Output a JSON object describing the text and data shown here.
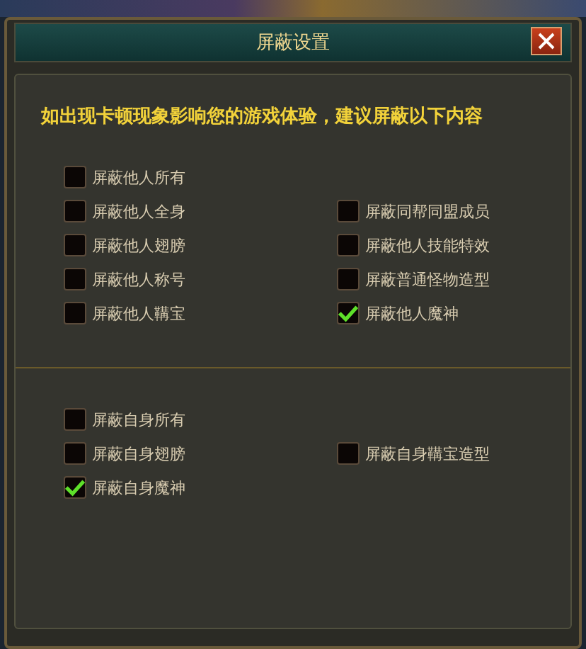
{
  "window": {
    "title": "屏蔽设置"
  },
  "notice": "如出现卡顿现象影响您的游戏体验，建议屏蔽以下内容",
  "sections": [
    {
      "rows": [
        {
          "left": {
            "label": "屏蔽他人所有",
            "checked": false
          }
        },
        {
          "left": {
            "label": "屏蔽他人全身",
            "checked": false
          },
          "right": {
            "label": "屏蔽同帮同盟成员",
            "checked": false
          }
        },
        {
          "left": {
            "label": "屏蔽他人翅膀",
            "checked": false
          },
          "right": {
            "label": "屏蔽他人技能特效",
            "checked": false
          }
        },
        {
          "left": {
            "label": "屏蔽他人称号",
            "checked": false
          },
          "right": {
            "label": "屏蔽普通怪物造型",
            "checked": false
          }
        },
        {
          "left": {
            "label": "屏蔽他人鞲宝",
            "checked": false
          },
          "right": {
            "label": "屏蔽他人魔神",
            "checked": true
          }
        }
      ]
    },
    {
      "rows": [
        {
          "left": {
            "label": "屏蔽自身所有",
            "checked": false
          }
        },
        {
          "left": {
            "label": "屏蔽自身翅膀",
            "checked": false
          },
          "right": {
            "label": "屏蔽自身鞲宝造型",
            "checked": false
          }
        },
        {
          "left": {
            "label": "屏蔽自身魔神",
            "checked": true
          }
        }
      ]
    }
  ]
}
